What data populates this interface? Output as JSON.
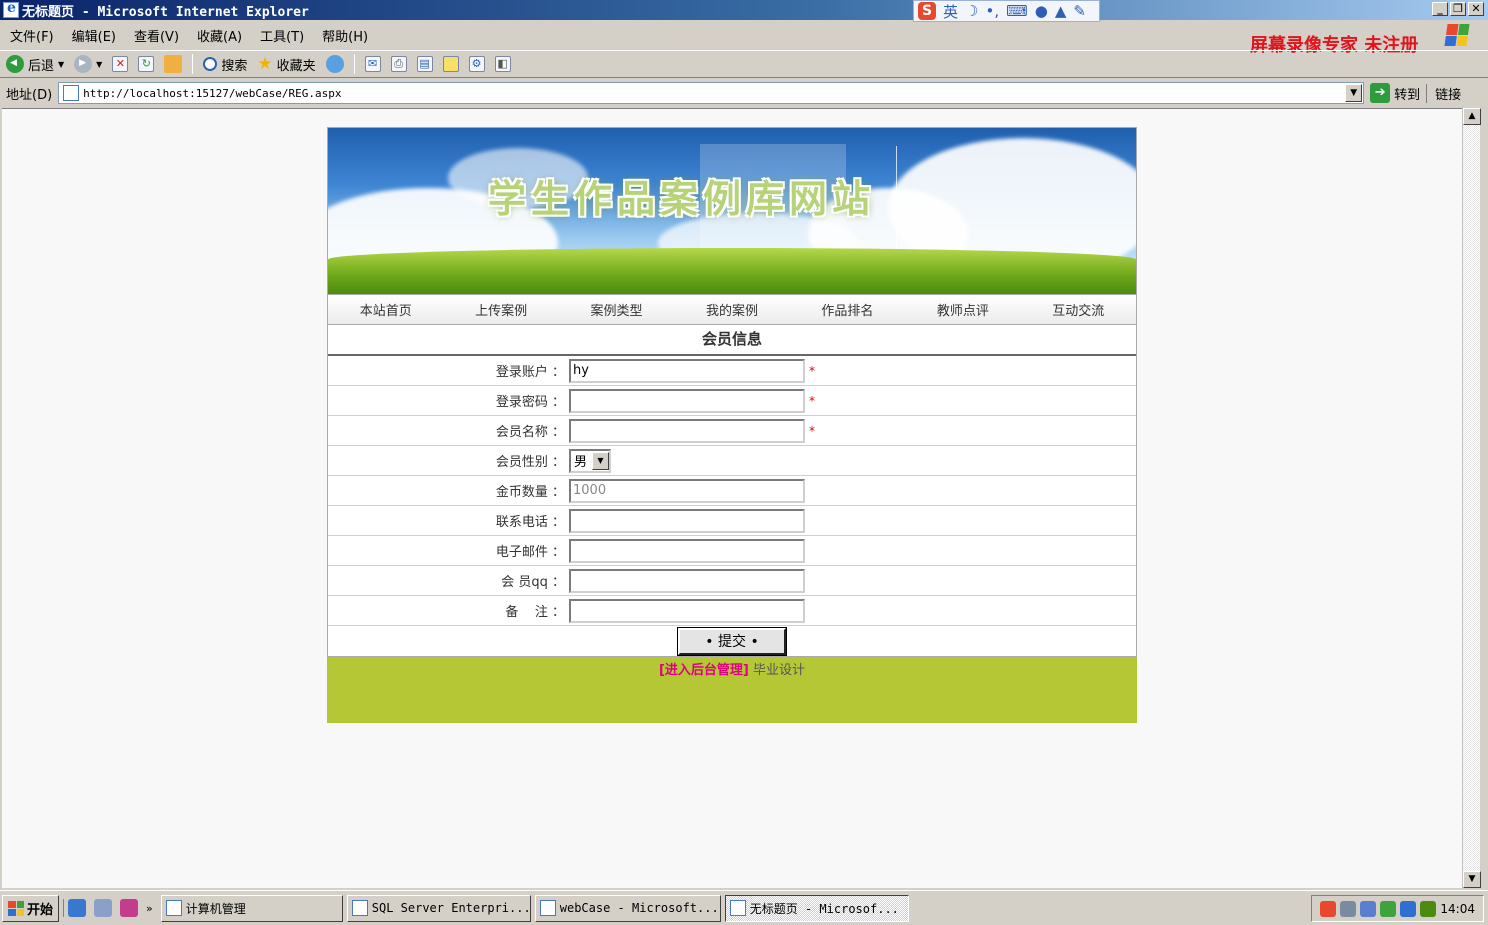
{
  "window": {
    "title": "无标题页 - Microsoft Internet Explorer"
  },
  "ime": {
    "lang": "英",
    "logo": "S"
  },
  "watermark": "屏幕录像专家 未注册",
  "menu": [
    "文件(F)",
    "编辑(E)",
    "查看(V)",
    "收藏(A)",
    "工具(T)",
    "帮助(H)"
  ],
  "toolbar": {
    "back": "后退",
    "search": "搜索",
    "favorites": "收藏夹"
  },
  "address": {
    "label": "地址(D)",
    "url": "http://localhost:15127/webCase/REG.aspx",
    "go": "转到",
    "links": "链接"
  },
  "site": {
    "banner_title": "学生作品案例库网站",
    "nav": [
      "本站首页",
      "上传案例",
      "案例类型",
      "我的案例",
      "作品排名",
      "教师点评",
      "互动交流"
    ]
  },
  "form": {
    "heading": "会员信息",
    "fields": [
      {
        "label": "登录账户 ：",
        "value": "hy",
        "required": "*"
      },
      {
        "label": "登录密码 ：",
        "value": "",
        "required": "*"
      },
      {
        "label": "会员名称 ：",
        "value": "",
        "required": "*"
      },
      {
        "label": "会员性别 ：",
        "value": "男"
      },
      {
        "label": "金币数量 ：",
        "value": "1000"
      },
      {
        "label": "联系电话 ：",
        "value": ""
      },
      {
        "label": "电子邮件 ：",
        "value": ""
      },
      {
        "label": "会 员qq ：",
        "value": ""
      },
      {
        "label": "备    注 ：",
        "value": ""
      }
    ],
    "submit": "• 提交 •"
  },
  "footer": {
    "admin": "[进入后台管理]",
    "text": "毕业设计"
  },
  "taskbar": {
    "start": "开始",
    "tasks": [
      "计算机管理",
      "SQL Server Enterpri...",
      "webCase - Microsoft...",
      "无标题页 - Microsof..."
    ],
    "clock": "14:04"
  }
}
